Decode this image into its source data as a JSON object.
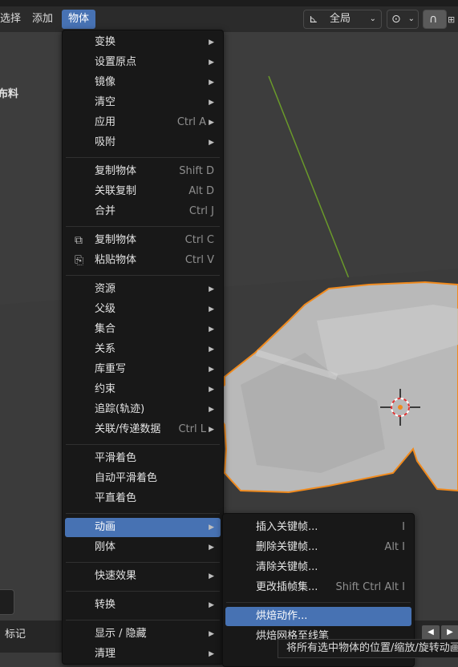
{
  "header": {
    "menus": [
      {
        "label": "选择",
        "active": false
      },
      {
        "label": "添加",
        "active": false
      },
      {
        "label": "物体",
        "active": true
      }
    ],
    "transform_orientation": "全局",
    "colors": {
      "highlight": "#4772b3",
      "menu_bg": "#181818",
      "header_bg": "#2b2b2b"
    }
  },
  "left_panel_label": "布料",
  "bottom": {
    "label": "标记"
  },
  "object_menu": {
    "groups": [
      [
        {
          "label": "变换",
          "shortcut": "",
          "submenu": true
        },
        {
          "label": "设置原点",
          "shortcut": "",
          "submenu": true
        },
        {
          "label": "镜像",
          "shortcut": "",
          "submenu": true
        },
        {
          "label": "清空",
          "shortcut": "",
          "submenu": true
        },
        {
          "label": "应用",
          "shortcut": "Ctrl A",
          "submenu": true
        },
        {
          "label": "吸附",
          "shortcut": "",
          "submenu": true
        }
      ],
      [
        {
          "label": "复制物体",
          "shortcut": "Shift D",
          "submenu": false
        },
        {
          "label": "关联复制",
          "shortcut": "Alt D",
          "submenu": false
        },
        {
          "label": "合并",
          "shortcut": "Ctrl J",
          "submenu": false
        }
      ],
      [
        {
          "label": "复制物体",
          "shortcut": "Ctrl C",
          "submenu": false,
          "icon": "copy-icon"
        },
        {
          "label": "粘贴物体",
          "shortcut": "Ctrl V",
          "submenu": false,
          "icon": "paste-icon"
        }
      ],
      [
        {
          "label": "资源",
          "shortcut": "",
          "submenu": true
        },
        {
          "label": "父级",
          "shortcut": "",
          "submenu": true
        },
        {
          "label": "集合",
          "shortcut": "",
          "submenu": true
        },
        {
          "label": "关系",
          "shortcut": "",
          "submenu": true
        },
        {
          "label": "库重写",
          "shortcut": "",
          "submenu": true
        },
        {
          "label": "约束",
          "shortcut": "",
          "submenu": true
        },
        {
          "label": "追踪(轨迹)",
          "shortcut": "",
          "submenu": true
        },
        {
          "label": "关联/传递数据",
          "shortcut": "Ctrl L",
          "submenu": true
        }
      ],
      [
        {
          "label": "平滑着色",
          "shortcut": "",
          "submenu": false
        },
        {
          "label": "自动平滑着色",
          "shortcut": "",
          "submenu": false
        },
        {
          "label": "平直着色",
          "shortcut": "",
          "submenu": false
        }
      ],
      [
        {
          "label": "动画",
          "shortcut": "",
          "submenu": true,
          "highlighted": true
        },
        {
          "label": "刚体",
          "shortcut": "",
          "submenu": true
        }
      ],
      [
        {
          "label": "快速效果",
          "shortcut": "",
          "submenu": true
        }
      ],
      [
        {
          "label": "转换",
          "shortcut": "",
          "submenu": true
        }
      ],
      [
        {
          "label": "显示 / 隐藏",
          "shortcut": "",
          "submenu": true
        },
        {
          "label": "清理",
          "shortcut": "",
          "submenu": true
        }
      ]
    ]
  },
  "animation_submenu": {
    "groups": [
      [
        {
          "label": "插入关键帧...",
          "shortcut": "I"
        },
        {
          "label": "删除关键帧...",
          "shortcut": "Alt I"
        },
        {
          "label": "清除关键帧...",
          "shortcut": ""
        },
        {
          "label": "更改插帧集...",
          "shortcut": "Shift Ctrl Alt I"
        }
      ],
      [
        {
          "label": "烘焙动作...",
          "shortcut": "",
          "highlighted": true
        },
        {
          "label": "烘焙网格至线笔",
          "shortcut": ""
        }
      ]
    ]
  },
  "tooltip": "将所有选中物体的位置/缩放/旋转动画"
}
